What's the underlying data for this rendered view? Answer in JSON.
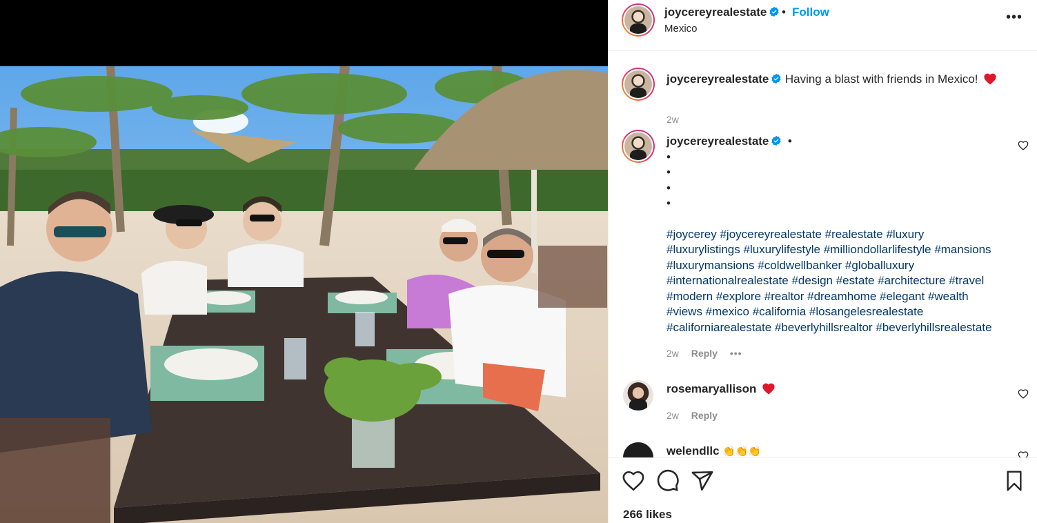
{
  "post": {
    "username": "joycereyrealestate",
    "follow_label": "Follow",
    "separator": "•",
    "location": "Mexico",
    "more_label": "•••",
    "likes": "266 likes"
  },
  "caption": {
    "username": "joycereyrealestate",
    "text": "Having a blast with friends in Mexico!",
    "time": "2w"
  },
  "comments": [
    {
      "username": "joycereyrealestate",
      "text": "•",
      "bullets": [
        "•",
        "•",
        "•",
        "•"
      ],
      "hashtags": [
        "#joycerey #joycereyrealestate #realestate #luxury",
        "#luxurylistings #luxurylifestyle #milliondollarlifestyle #mansions",
        "#luxurymansions #coldwellbanker #globalluxury",
        "#internationalrealestate #design #estate #architecture #travel",
        "#modern #explore #realtor #dreamhome #elegant #wealth",
        "#views #mexico #california #losangelesrealestate",
        "#californiarealestate #beverlyhillsrealtor #beverlyhillsrealestate"
      ],
      "time": "2w",
      "reply": "Reply",
      "options": "•••"
    },
    {
      "username": "rosemaryallison",
      "time": "2w",
      "reply": "Reply"
    },
    {
      "username": "welendllc",
      "text": "👏👏👏"
    }
  ],
  "colors": {
    "accent": "#0095f6",
    "hashtag": "#00376b",
    "muted": "#8e8e8e",
    "heart": "#ed4956"
  }
}
